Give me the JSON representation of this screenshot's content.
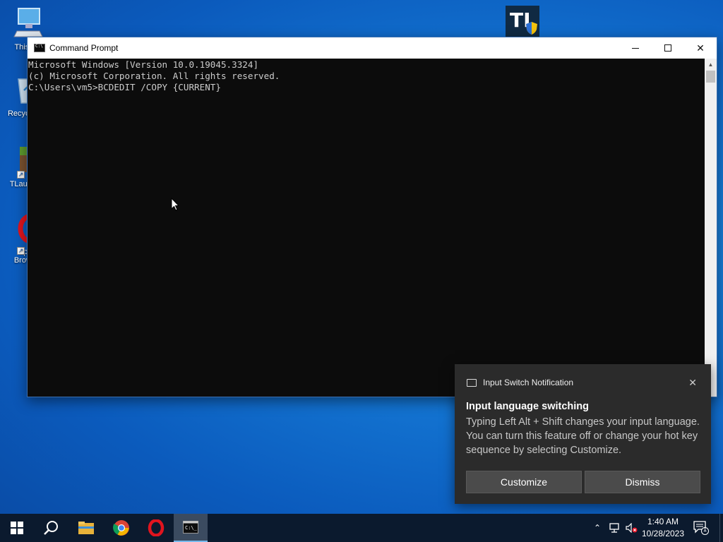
{
  "desktop": {
    "icons": [
      {
        "label": "This PC"
      },
      {
        "label": "Recycle Bin"
      },
      {
        "label": "TLauncher"
      },
      {
        "label": "Opera Browser"
      }
    ]
  },
  "window": {
    "title": "Command Prompt",
    "console_lines": [
      "Microsoft Windows [Version 10.0.19045.3324]",
      "(c) Microsoft Corporation. All rights reserved.",
      "",
      "C:\\Users\\vm5>BCDEDIT /COPY {CURRENT}"
    ]
  },
  "notification": {
    "app_name": "Input Switch Notification",
    "title": "Input language switching",
    "body": "Typing Left Alt + Shift changes your input language. You can turn this feature off or change your hot key sequence by selecting Customize.",
    "customize_label": "Customize",
    "dismiss_label": "Dismiss",
    "close_glyph": "✕"
  },
  "taskbar": {
    "time": "1:40 AM",
    "date": "10/28/2023",
    "notification_count": "1",
    "pinned": [
      "start-icon",
      "search-icon",
      "file-explorer-icon",
      "chrome-icon",
      "opera-icon",
      "command-prompt-icon"
    ]
  },
  "colors": {
    "console_bg": "#0c0c0c",
    "console_text": "#cccccc",
    "toast_bg": "#2b2b2b",
    "taskbar_bg": "#0b1a2e"
  }
}
